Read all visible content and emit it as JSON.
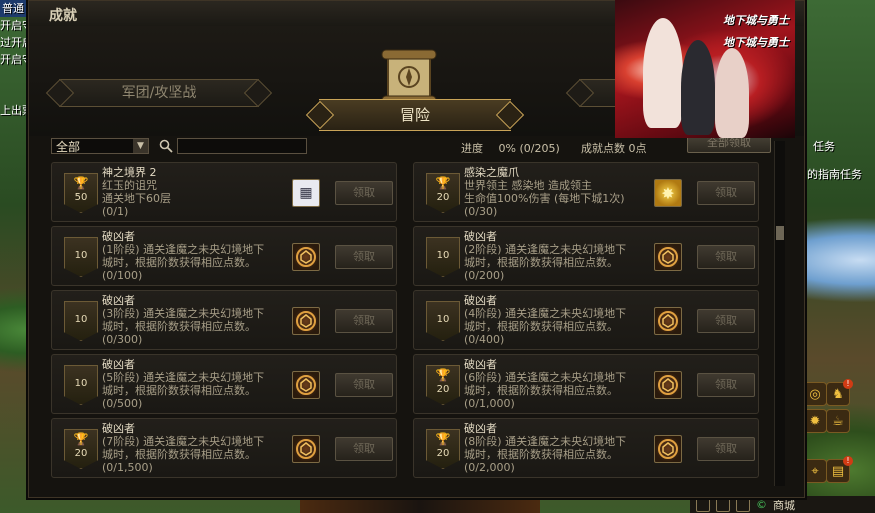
{
  "background": {
    "left_chat": [
      "普通",
      "开启守",
      "过开启",
      "开启守",
      "上出票"
    ],
    "right_quest": [
      "任务",
      "的指南任务"
    ],
    "bottom_bar_label": "商城"
  },
  "window": {
    "title": "成就",
    "tabs": [
      {
        "label": "军团/攻坚战",
        "active": false
      },
      {
        "label": "冒险",
        "active": true
      },
      {
        "label": "",
        "active": false
      }
    ],
    "filter": {
      "value": "全部"
    },
    "search": {
      "value": "",
      "placeholder": ""
    },
    "progress_label": "进度",
    "progress_value": "0%  (0/205)",
    "progress_fraction": 0,
    "points_label": "成就点数",
    "points_value": "0点",
    "claim_all_label": "全部领取",
    "claim_label": "领取"
  },
  "cards": [
    {
      "title": "神之境界 2",
      "desc": "红玉的诅咒\n通关地下60层",
      "count": "(0/1)",
      "points": "50",
      "trophy": true,
      "reward_icon": "card-item-icon"
    },
    {
      "title": "感染之魔爪",
      "desc": "世界领主  感染地        造成领主\n生命值100%伤害 (每地下城1次)",
      "count": "(0/30)",
      "points": "20",
      "trophy": true,
      "reward_icon": "gold-item-icon"
    },
    {
      "title": "破凶者",
      "desc": "(1阶段) 通关逢魔之未央幻境地下\n城时，根据阶数获得相应点数。",
      "count": "(0/100)",
      "points": "10",
      "trophy": false,
      "reward_icon": "seal-item-icon"
    },
    {
      "title": "破凶者",
      "desc": "(2阶段) 通关逢魔之未央幻境地下\n城时，根据阶数获得相应点数。",
      "count": "(0/200)",
      "points": "10",
      "trophy": false,
      "reward_icon": "seal-item-icon"
    },
    {
      "title": "破凶者",
      "desc": "(3阶段) 通关逢魔之未央幻境地下\n城时，根据阶数获得相应点数。",
      "count": "(0/300)",
      "points": "10",
      "trophy": false,
      "reward_icon": "seal-item-icon"
    },
    {
      "title": "破凶者",
      "desc": "(4阶段) 通关逢魔之未央幻境地下\n城时，根据阶数获得相应点数。",
      "count": "(0/400)",
      "points": "10",
      "trophy": false,
      "reward_icon": "seal-item-icon"
    },
    {
      "title": "破凶者",
      "desc": "(5阶段) 通关逢魔之未央幻境地下\n城时，根据阶数获得相应点数。",
      "count": "(0/500)",
      "points": "10",
      "trophy": false,
      "reward_icon": "seal-item-icon"
    },
    {
      "title": "破凶者",
      "desc": "(6阶段) 通关逢魔之未央幻境地下\n城时，根据阶数获得相应点数。",
      "count": "(0/1,000)",
      "points": "20",
      "trophy": true,
      "reward_icon": "seal-item-icon"
    },
    {
      "title": "破凶者",
      "desc": "(7阶段) 通关逢魔之未央幻境地下\n城时，根据阶数获得相应点数。",
      "count": "(0/1,500)",
      "points": "20",
      "trophy": true,
      "reward_icon": "seal-item-icon"
    },
    {
      "title": "破凶者",
      "desc": "(8阶段) 通关逢魔之未央幻境地下\n城时，根据阶数获得相应点数。",
      "count": "(0/2,000)",
      "points": "20",
      "trophy": true,
      "reward_icon": "seal-item-icon"
    }
  ],
  "ad": {
    "logo": "地下城与勇士"
  },
  "colors": {
    "accent_gold": "#c9a458",
    "panel_bg": "#15130f",
    "text_main": "#e2d9c2",
    "text_dim": "#a89f88"
  }
}
